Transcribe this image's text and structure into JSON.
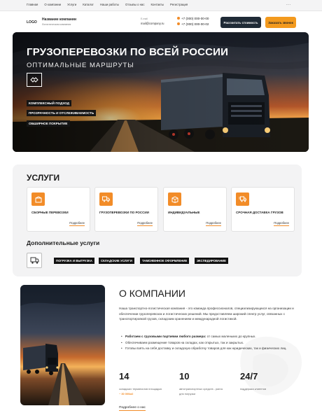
{
  "nav": {
    "items": [
      "Главная",
      "О компании",
      "Услуги",
      "Каталог",
      "Наши работы",
      "Отзывы о нас",
      "Контакты",
      "Регистрация"
    ],
    "more": "..."
  },
  "header": {
    "logo": "LOGO",
    "company_name": "Название компании",
    "company_sub": "Логистическая компания",
    "email_label": "E-mail",
    "email": "mail@company.ru",
    "phone1": "+7 (000) 000-00-00",
    "phone2": "+7 (000) 000-00-02",
    "calc_button": "Рассчитать стоимость",
    "order_button": "Заказать звонок"
  },
  "hero": {
    "title": "ГРУЗОПЕРЕВОЗКИ ПО ВСЕЙ РОССИИ",
    "subtitle": "ОПТИМАЛЬНЫЕ МАРШРУТЫ",
    "tags": [
      "КОМПЛЕКСНЫЙ ПОДХОД",
      "ПРОЗРАЧНОСТЬ И ОТСЛЕЖИВАЕМОСТЬ",
      "ОБШИРНОЕ ПОКРЫТИЕ"
    ],
    "icon": "handshake-icon"
  },
  "services": {
    "title": "УСЛУГИ",
    "cards": [
      {
        "name": "СБОРНЫЕ ПЕРЕВОЗКИ",
        "more": "Подробнее",
        "icon": "cargo-icon"
      },
      {
        "name": "ГРУЗОПЕРЕВОЗКИ ПО РОССИИ",
        "more": "Подробнее",
        "icon": "truck-icon"
      },
      {
        "name": "ИНДИВИДУАЛЬНЫЕ",
        "more": "Подробнее",
        "icon": "box-icon"
      },
      {
        "name": "СРОЧНАЯ ДОСТАВКА ГРУЗОВ",
        "more": "Подробнее",
        "icon": "fast-truck-icon"
      }
    ],
    "additional_title": "Дополнительные услуги",
    "additional_icon": "loading-icon",
    "additional": [
      "ПОГРУЗКА И ВЫГРУЗКА",
      "СКЛАДСКИЕ УСЛУГИ",
      "ТАМОЖЕННОЕ ОФОРМЛЕНИЕ",
      "ЭКСПЕДИРОВАНИЕ"
    ]
  },
  "about": {
    "title": "О КОМПАНИИ",
    "text": "Наша транспортно-логистическая компания - это команда профессионалов, специализирующихся на организации и обеспечении грузоперевозок и логистических решений. Мы предоставляем широкий спектр услуг, связанных с транспортировкой грузов, складским хранением и международной логистикой.",
    "bullets": [
      {
        "bold": "Работаем с грузовыми партиями любого размера:",
        "rest": " от самых маленьких до крупных."
      },
      {
        "bold": "",
        "rest": "Обеспечиваем размещение товаров на складах, как открытых, так и закрытых."
      },
      {
        "bold": "",
        "rest": "Готовы взять на себя доставку и складскую обработку товаров для как юридических, так и физических лиц."
      }
    ],
    "stats": [
      {
        "num": "14",
        "label": "складских терминалов площадью",
        "accent": "~ 30 000м2"
      },
      {
        "num": "10",
        "label": "автотранспортных средств - ранга для погрузки",
        "accent": ""
      },
      {
        "num": "24/7",
        "label": "поддержка клиентов",
        "accent": ""
      }
    ],
    "more": "Подробнее о нас"
  },
  "colors": {
    "accent": "#f28c28",
    "dark": "#1f2a36",
    "orange_button": "#f39a1e"
  }
}
